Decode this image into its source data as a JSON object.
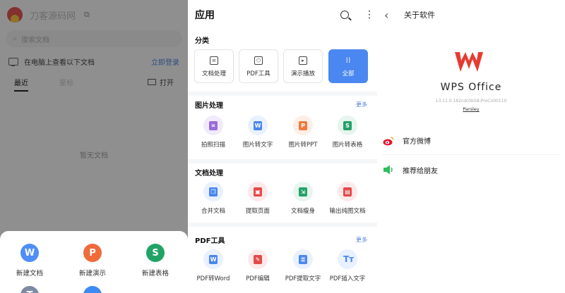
{
  "home": {
    "app_name": "刀客源码网",
    "search_placeholder": "搜索文档",
    "pc_text": "在电脑上查看以下文档",
    "pc_login": "立即登录",
    "tabs": [
      "最近",
      "星标"
    ],
    "open_label": "打开",
    "empty_text": "暂无文档",
    "sheet": [
      {
        "label": "新建文档",
        "letter": "W",
        "color": "#4f8ef7",
        "icon": "writer-icon"
      },
      {
        "label": "新建演示",
        "letter": "P",
        "color": "#f06a3a",
        "icon": "presentation-icon"
      },
      {
        "label": "新建表格",
        "letter": "S",
        "color": "#21a366",
        "icon": "spreadsheet-icon"
      },
      {
        "label": "",
        "letter": "T",
        "color": "#7c8aa5",
        "icon": "text-icon"
      },
      {
        "label": "",
        "letter": "",
        "color": "#3d8bf2",
        "icon": "folder-icon"
      }
    ]
  },
  "apps": {
    "title": "应用",
    "more_label": "更多",
    "category_title": "分类",
    "categories": [
      {
        "label": "文档处理",
        "icon": "document-icon"
      },
      {
        "label": "PDF工具",
        "icon": "pdf-icon"
      },
      {
        "label": "演示播放",
        "icon": "play-icon"
      },
      {
        "label": "全部",
        "icon": "grid-icon"
      }
    ],
    "sections": [
      {
        "title": "图片处理",
        "has_more": true,
        "tools": [
          {
            "label": "拍照扫描",
            "icon": "scan-icon",
            "color": "#9b6bd8",
            "bg": "#f1eafb"
          },
          {
            "label": "图片转文字",
            "icon": "image-to-text-icon",
            "color": "#4a87f0",
            "bg": "#e9f1fe"
          },
          {
            "label": "图片转PPT",
            "icon": "image-to-ppt-icon",
            "color": "#f07a3c",
            "bg": "#fdeee6"
          },
          {
            "label": "图片转表格",
            "icon": "image-to-sheet-icon",
            "color": "#26a06a",
            "bg": "#e6f5ee"
          }
        ]
      },
      {
        "title": "文档处理",
        "has_more": false,
        "tools": [
          {
            "label": "合并文档",
            "icon": "merge-icon",
            "color": "#4a87f0",
            "bg": "#e9f1fe"
          },
          {
            "label": "提取页面",
            "icon": "extract-page-icon",
            "color": "#e24a4a",
            "bg": "#fde9e9"
          },
          {
            "label": "文档瘦身",
            "icon": "compress-icon",
            "color": "#26a06a",
            "bg": "#e6f5ee"
          },
          {
            "label": "输出纯图文档",
            "icon": "export-image-icon",
            "color": "#e24a4a",
            "bg": "#fde9e9"
          }
        ]
      },
      {
        "title": "PDF工具",
        "has_more": true,
        "tools": [
          {
            "label": "PDF转Word",
            "icon": "pdf-to-word-icon",
            "color": "#4a87f0",
            "bg": "#e9f1fe"
          },
          {
            "label": "PDF编辑",
            "icon": "pdf-edit-icon",
            "color": "#e24a4a",
            "bg": "#fde9e9"
          },
          {
            "label": "PDF提取文字",
            "icon": "pdf-extract-text-icon",
            "color": "#4a87f0",
            "bg": "#e9f1fe"
          },
          {
            "label": "PDF插入文字",
            "icon": "pdf-insert-text-icon",
            "color": "#4a87f0",
            "bg": "#e9f1fe"
          }
        ]
      }
    ]
  },
  "about": {
    "title": "关于软件",
    "product": "WPS Office",
    "version": "13.11.0.182cdc0b58-ProCn00110",
    "parsley": "Parsley",
    "rows": [
      {
        "label": "官方微博",
        "icon": "weibo-icon",
        "color": "#e6162d"
      },
      {
        "label": "推荐给朋友",
        "icon": "share-speaker-icon",
        "color": "#2fbe5b"
      }
    ],
    "brand_color": "#e83a30"
  }
}
